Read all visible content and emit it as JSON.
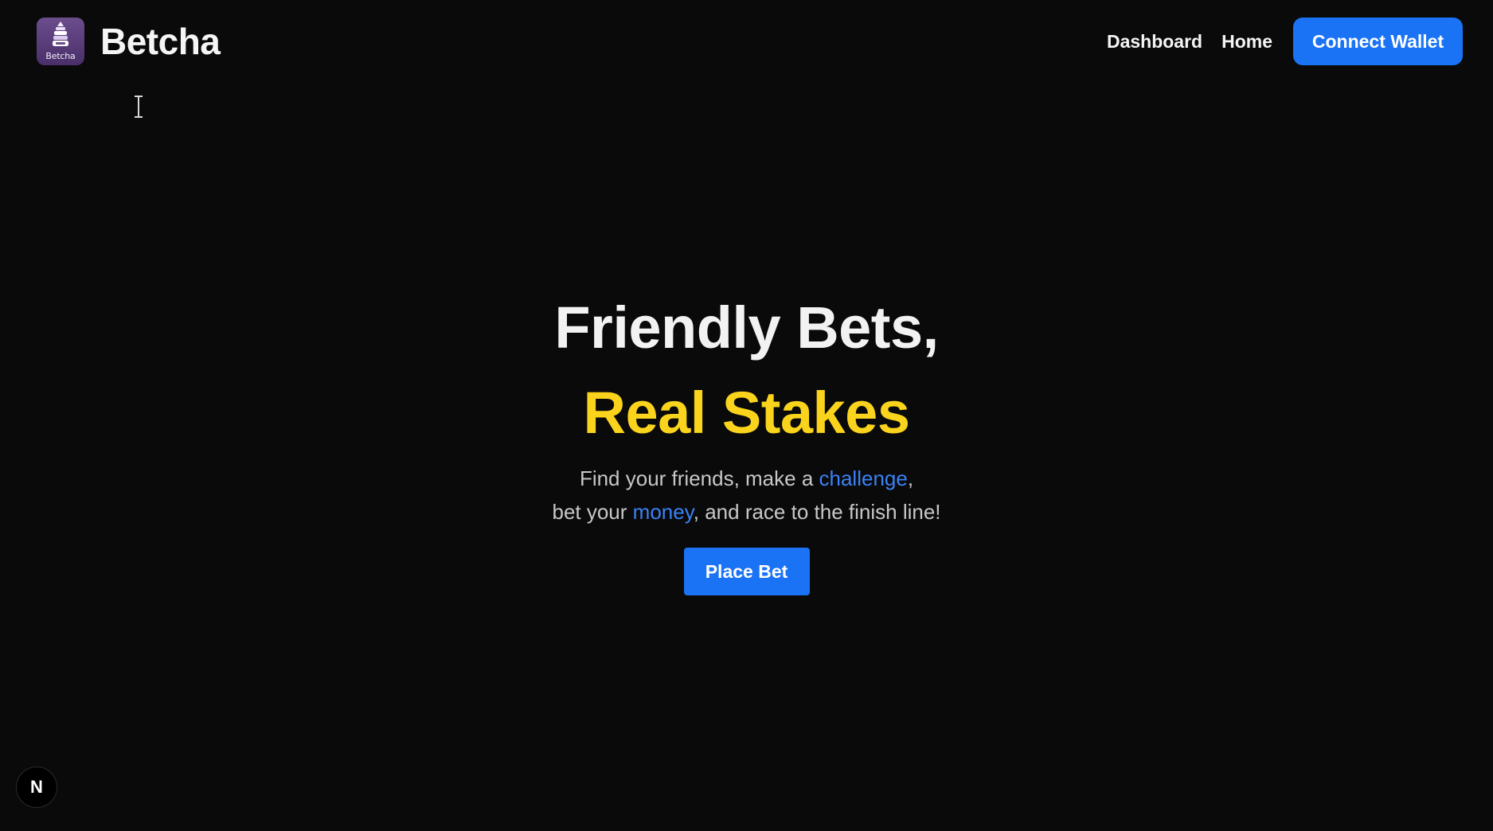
{
  "header": {
    "logo_text": "Betcha",
    "brand_name": "Betcha",
    "nav": {
      "dashboard": "Dashboard",
      "home": "Home"
    },
    "connect_wallet": "Connect Wallet"
  },
  "hero": {
    "title": "Friendly Bets,",
    "subtitle": "Real Stakes",
    "desc_line1_pre": "Find your friends, make a ",
    "desc_line1_accent": "challenge",
    "desc_line1_post": ",",
    "desc_line2_pre": "bet your ",
    "desc_line2_accent": "money",
    "desc_line2_post": ", and race to the finish line!",
    "cta": "Place Bet"
  },
  "badge": {
    "letter": "N"
  },
  "colors": {
    "background": "#0a0a0a",
    "primary_blue": "#1a73f5",
    "accent_blue": "#3a82f7",
    "highlight_yellow": "#fad41c",
    "logo_purple": "#5b3d7c"
  },
  "icons": {
    "logo": "betcha-logo-icon",
    "cursor": "text-cursor-icon",
    "badge": "nextjs-badge-icon"
  }
}
